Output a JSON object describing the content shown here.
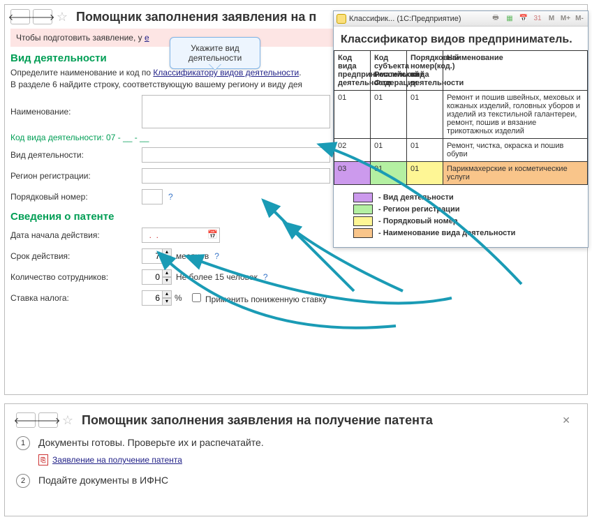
{
  "panel1": {
    "title": "Помощник заполнения заявления на п",
    "warning_prefix": "Чтобы подготовить заявление, у",
    "warning_link": "е",
    "callout": "Укажите вид деятельности",
    "section1_heading": "Вид деятельности",
    "desc_part1": "Определите наименование и код по ",
    "desc_link": "Классификатору видов деятельности",
    "desc_part2": "В разделе 6 найдите строку, соответствующую вашему региону и виду дея",
    "labels": {
      "name": "Наименование:",
      "code_line": "Код вида деятельности: 07 - __ - __",
      "activity_type": "Вид деятельности:",
      "region": "Регион регистрации:",
      "ordinal": "Порядковый номер:"
    },
    "ordinal_value": "",
    "section2_heading": "Сведения о патенте",
    "patent": {
      "start_label": "Дата начала действия:",
      "start_value": "  .  .",
      "term_label": "Срок действия:",
      "term_value": "7",
      "term_suffix": "месяцев",
      "emp_label": "Количество сотрудников:",
      "emp_value": "0",
      "emp_hint": "Не более 15 человек",
      "rate_label": "Ставка налога:",
      "rate_value": "6",
      "rate_pct": "%",
      "reduced_label": "Применить пониженную ставку"
    }
  },
  "classifier": {
    "titlebar": "Классифик... (1С:Предприятие)",
    "m_items": [
      "M",
      "M+",
      "M-"
    ],
    "heading": "Классификатор видов предприниматель.",
    "headers": {
      "c1": "Код вида предпринимательской деятельности",
      "c2": "Код субъекта Российской Федерации",
      "c3": "Порядковый номер(код.) вида деятельности",
      "c4": "Наименование"
    },
    "rows": [
      {
        "c1": "01",
        "c2": "01",
        "c3": "01",
        "c4": "Ремонт и пошив швейных, меховых и кожаных изделий, головных уборов и изделий из текстильной галантереи, ремонт, пошив и вязание трикотажных изделий"
      },
      {
        "c1": "02",
        "c2": "01",
        "c3": "01",
        "c4": "Ремонт, чистка, окраска и пошив обуви"
      },
      {
        "c1": "03",
        "c2": "01",
        "c3": "01",
        "c4": "Парикмахерские и косметические услуги"
      }
    ],
    "legend": [
      {
        "color": "purple",
        "label": "- Вид деятельности"
      },
      {
        "color": "green",
        "label": "- Регион регистрации"
      },
      {
        "color": "yellow",
        "label": "- Порядковый номер"
      },
      {
        "color": "orange",
        "label": "- Наименование вида деятельности"
      }
    ]
  },
  "panel2": {
    "title": "Помощник заполнения заявления на получение патента",
    "step1_num": "1",
    "step1_text": "Документы готовы. Проверьте их и распечатайте.",
    "pdf_link": "Заявление на получение патента",
    "step2_num": "2",
    "step2_text": "Подайте документы в ИФНС"
  }
}
